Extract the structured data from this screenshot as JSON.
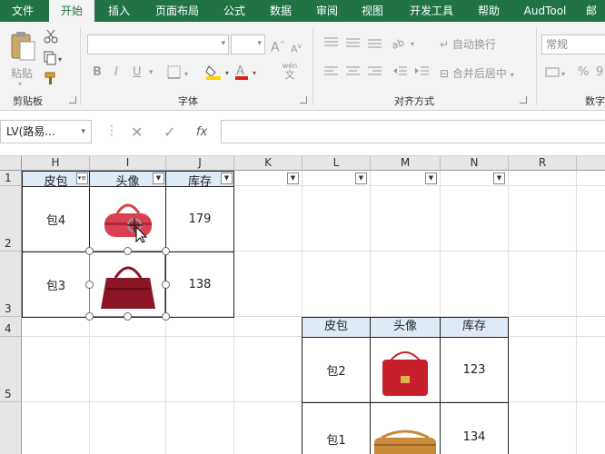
{
  "ribbon_tabs": [
    "文件",
    "开始",
    "插入",
    "页面布局",
    "公式",
    "数据",
    "审阅",
    "视图",
    "开发工具",
    "帮助",
    "AudTool",
    "邮"
  ],
  "active_tab": "开始",
  "clipboard": {
    "paste_label": "粘贴",
    "group_label": "剪贴板"
  },
  "font": {
    "group_label": "字体",
    "bold": "B",
    "italic": "I",
    "underline": "U",
    "phonetic_top": "wén",
    "phonetic_bottom": "文",
    "grow_font": "A",
    "shrink_font": "A"
  },
  "alignment": {
    "group_label": "对齐方式",
    "wrap_text": "自动换行",
    "merge_center": "合并后居中"
  },
  "number": {
    "format_value": "常规",
    "group_label": "数字",
    "percent": "%",
    "comma": "9"
  },
  "formula_bar": {
    "name_box": "LV(路易...",
    "fx_label": "fx",
    "cancel": "✕",
    "enter": "✓",
    "content": ""
  },
  "columns": [
    "H",
    "I",
    "J",
    "K",
    "L",
    "M",
    "N",
    "R"
  ],
  "rows": [
    "1",
    "2",
    "3",
    "4",
    "5"
  ],
  "table1": {
    "headers": [
      "皮包",
      "头像",
      "库存"
    ],
    "rows": [
      {
        "name": "包4",
        "stock": "179",
        "bag_color": "#d94050"
      },
      {
        "name": "包3",
        "stock": "138",
        "bag_color": "#8c1525"
      }
    ]
  },
  "table2": {
    "headers": [
      "皮包",
      "头像",
      "库存"
    ],
    "rows": [
      {
        "name": "包2",
        "stock": "123",
        "bag_color": "#c8202a"
      },
      {
        "name": "包1",
        "stock": "134",
        "bag_color": "#c98a3a"
      }
    ]
  },
  "colors": {
    "excel_green": "#217346",
    "header_fill": "#deeaf6"
  },
  "icons": [
    "scissors-icon",
    "copy-icon",
    "format-painter-icon",
    "fill-color-icon",
    "font-color-icon",
    "borders-icon",
    "orientation-icon",
    "cancel-icon",
    "enter-icon",
    "fx-icon",
    "move-cursor-icon",
    "filter-dropdown-icon"
  ]
}
